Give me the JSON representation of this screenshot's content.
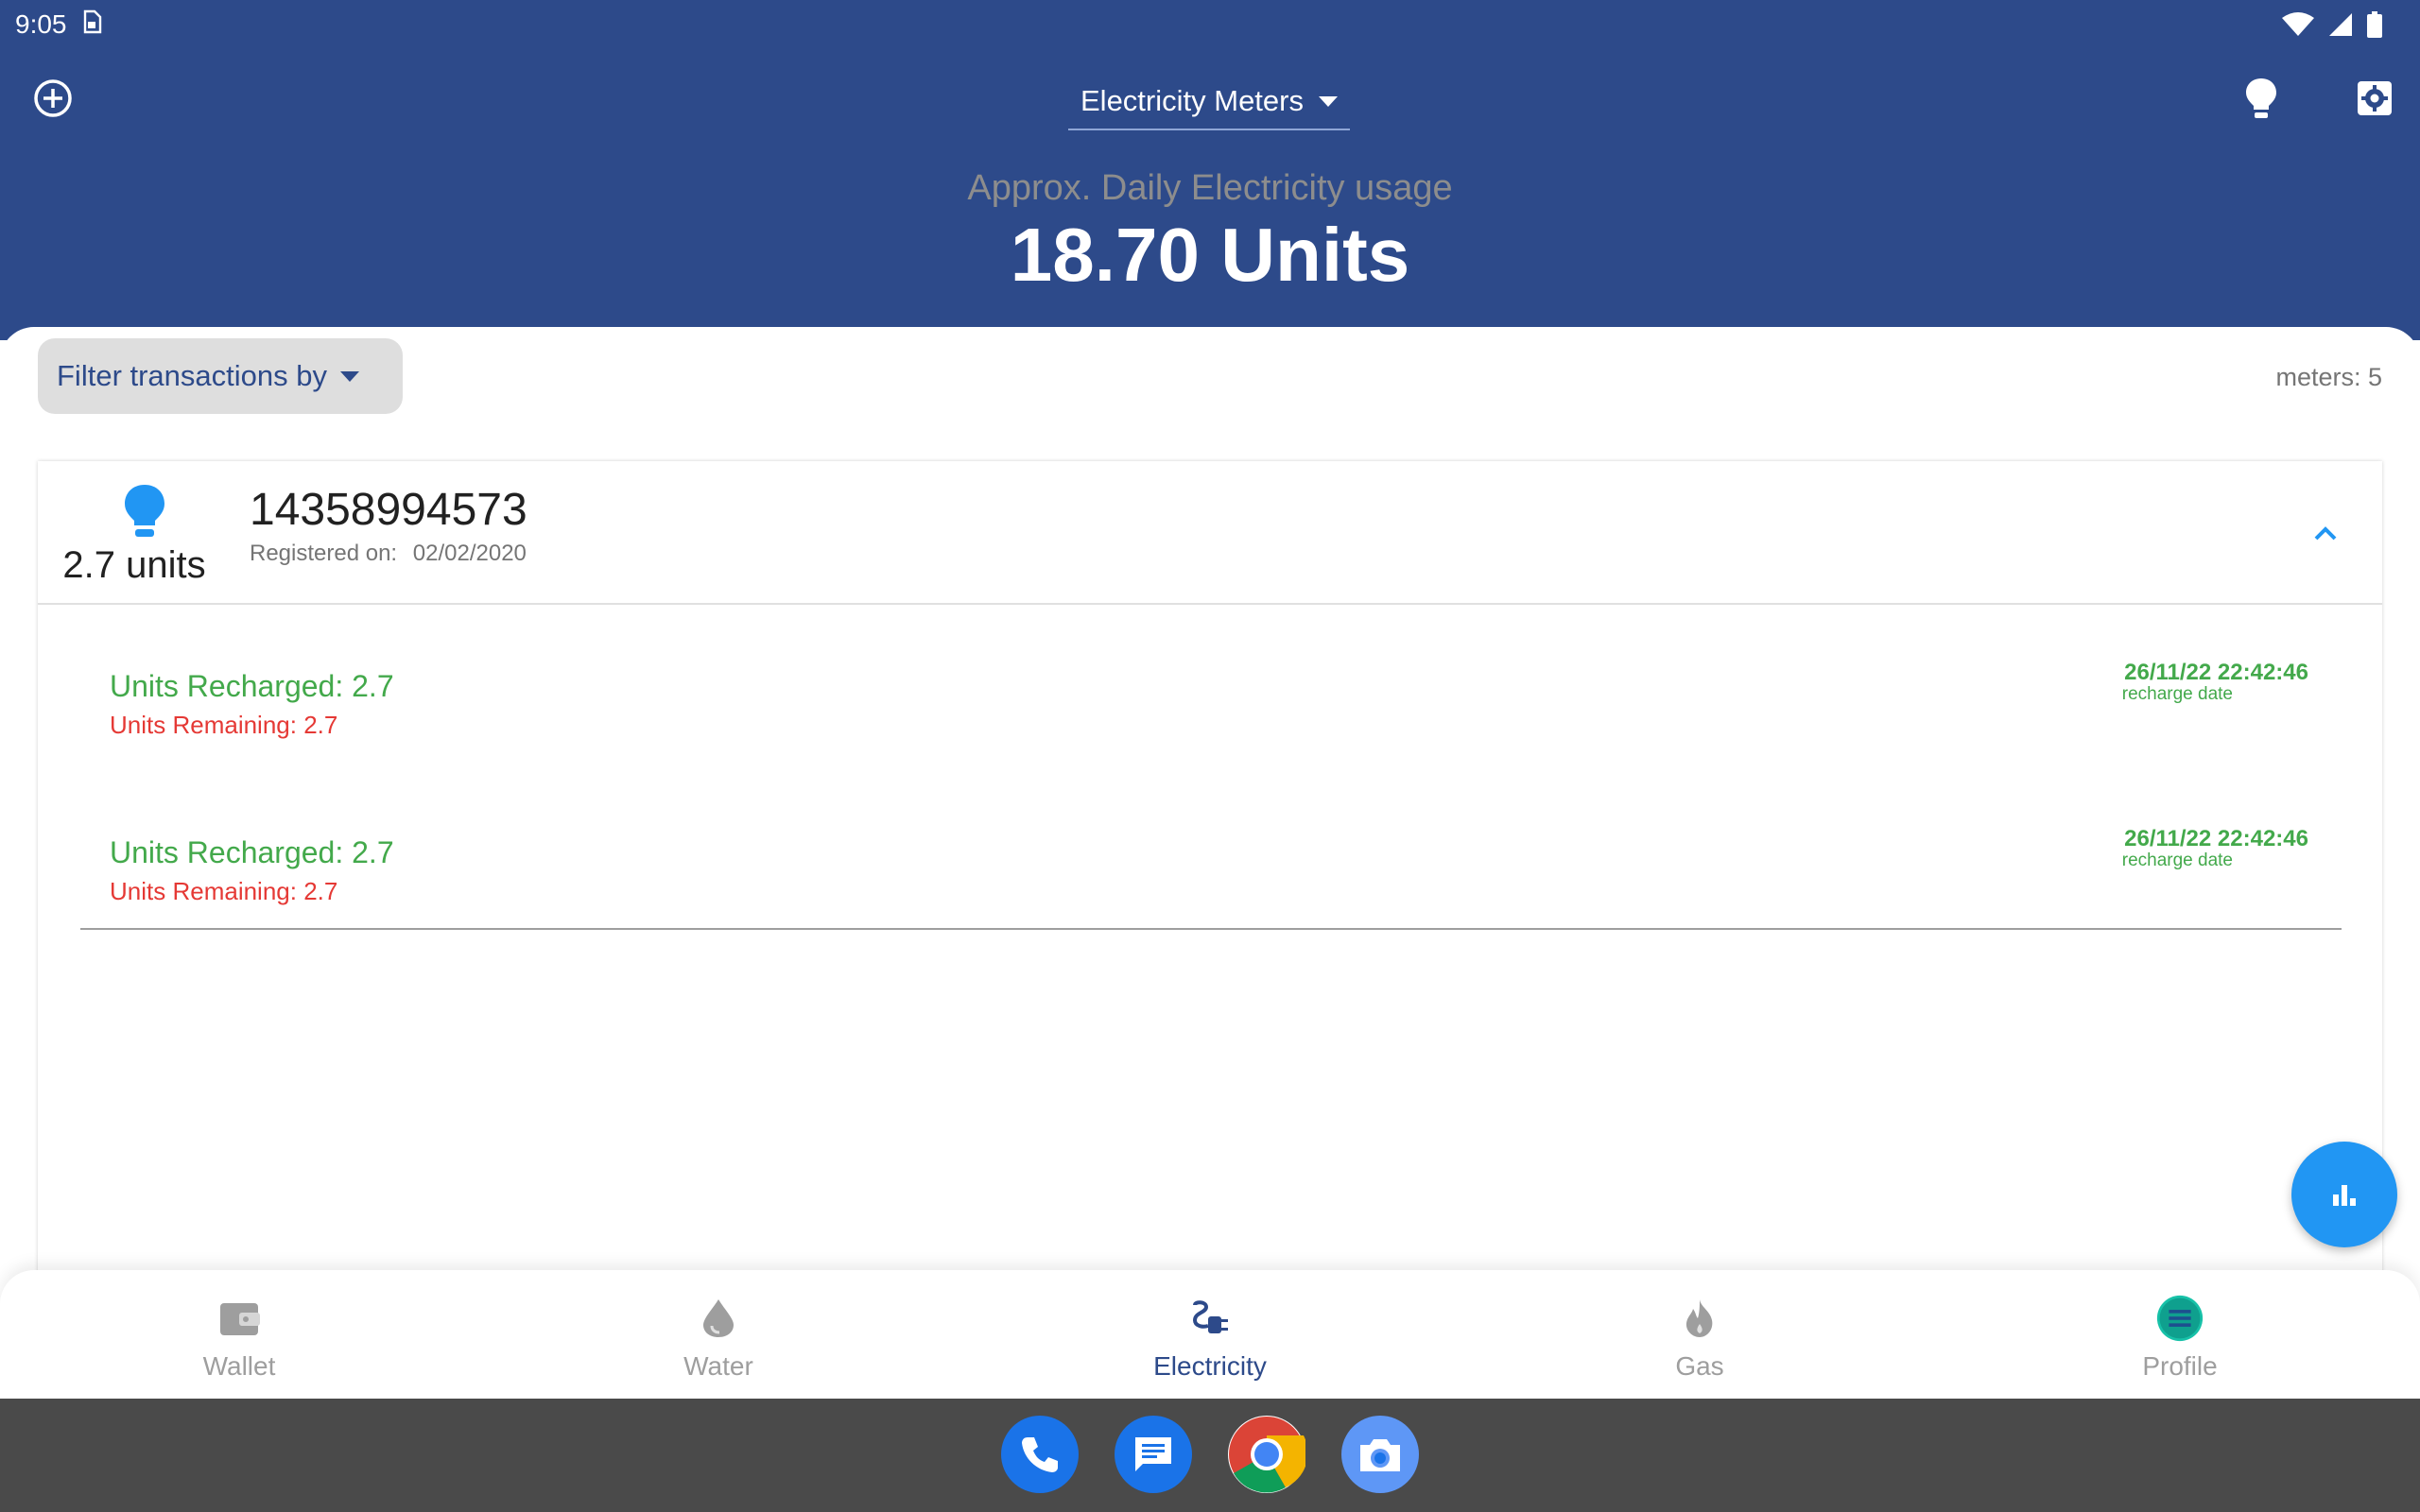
{
  "status_bar": {
    "time": "9:05"
  },
  "header": {
    "meter_type": "Electricity Meters",
    "usage_label": "Approx. Daily Electricity usage",
    "usage_value": "18.70 Units"
  },
  "filter": {
    "label": "Filter transactions by"
  },
  "meters_count": "meters: 5",
  "meter_card": {
    "units": "2.7 units",
    "meter_number": "14358994573",
    "registered_label": "Registered on:",
    "registered_date": "02/02/2020",
    "transactions": [
      {
        "recharged": "Units Recharged: 2.7",
        "remaining": "Units Remaining: 2.7",
        "date": "26/11/22 22:42:46",
        "date_label": "recharge date"
      },
      {
        "recharged": "Units Recharged: 2.7",
        "remaining": "Units Remaining: 2.7",
        "date": "26/11/22 22:42:46",
        "date_label": "recharge date"
      }
    ]
  },
  "bottom_nav": {
    "items": [
      {
        "label": "Wallet",
        "icon": "wallet-icon"
      },
      {
        "label": "Water",
        "icon": "water-drop-icon"
      },
      {
        "label": "Electricity",
        "icon": "electricity-plug-icon",
        "active": true
      },
      {
        "label": "Gas",
        "icon": "flame-icon"
      },
      {
        "label": "Profile",
        "icon": "profile-menu-icon"
      }
    ]
  },
  "dock": {
    "apps": [
      "phone-icon",
      "messages-icon",
      "chrome-icon",
      "camera-icon"
    ]
  },
  "colors": {
    "header_bg": "#2d4a8a",
    "accent_blue": "#2196f3",
    "recharged_green": "#43a94b",
    "remaining_red": "#e53935"
  }
}
